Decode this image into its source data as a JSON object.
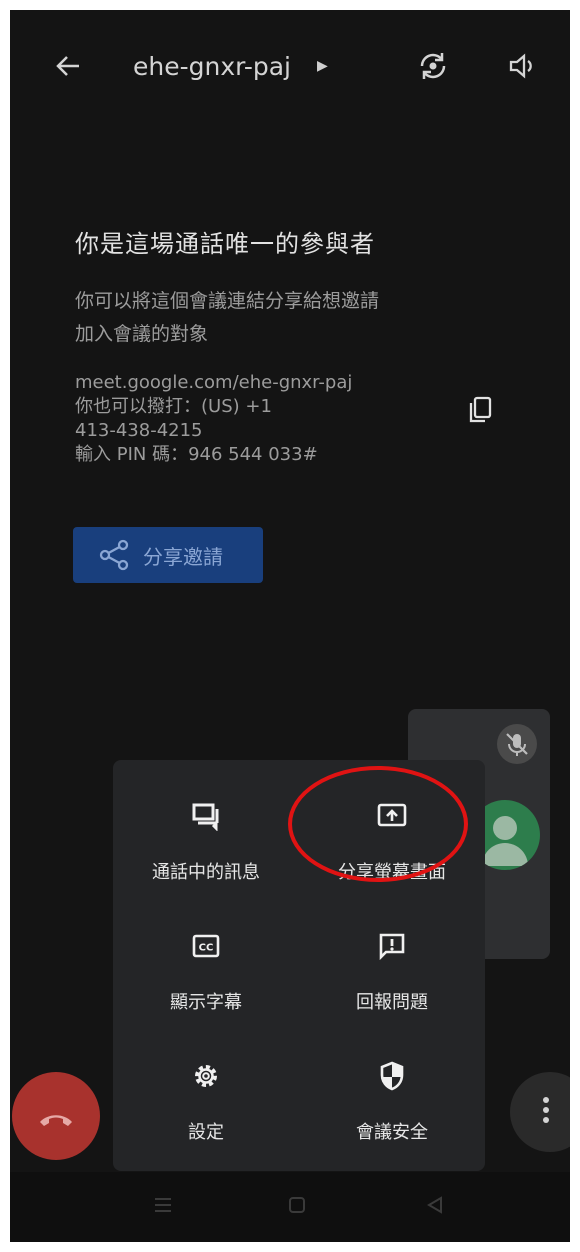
{
  "meeting": {
    "code": "ehe-gnxr-paj",
    "heading": "你是這場通話唯一的參與者",
    "description_line1": "你可以將這個會議連結分享給想邀請",
    "description_line2": "加入會議的對象",
    "link": "meet.google.com/ehe-gnxr-paj",
    "dial_prefix": "你也可以撥打：(US) +1",
    "phone": "413-438-4215",
    "pin": "輸入 PIN 碼：946 544 033#",
    "share_button_label": "分享邀請"
  },
  "menu": {
    "items": [
      {
        "label": "通話中的訊息",
        "icon": "chat-icon"
      },
      {
        "label": "分享螢幕畫面",
        "icon": "present-screen-icon"
      },
      {
        "label": "顯示字幕",
        "icon": "closed-caption-icon"
      },
      {
        "label": "回報問題",
        "icon": "feedback-icon"
      },
      {
        "label": "設定",
        "icon": "gear-icon"
      },
      {
        "label": "會議安全",
        "icon": "shield-icon"
      }
    ]
  },
  "colors": {
    "background": "#141414",
    "menu": "#242527",
    "share_button": "#193f7d",
    "end_call": "#a8322d",
    "annotation": "#e01313"
  }
}
